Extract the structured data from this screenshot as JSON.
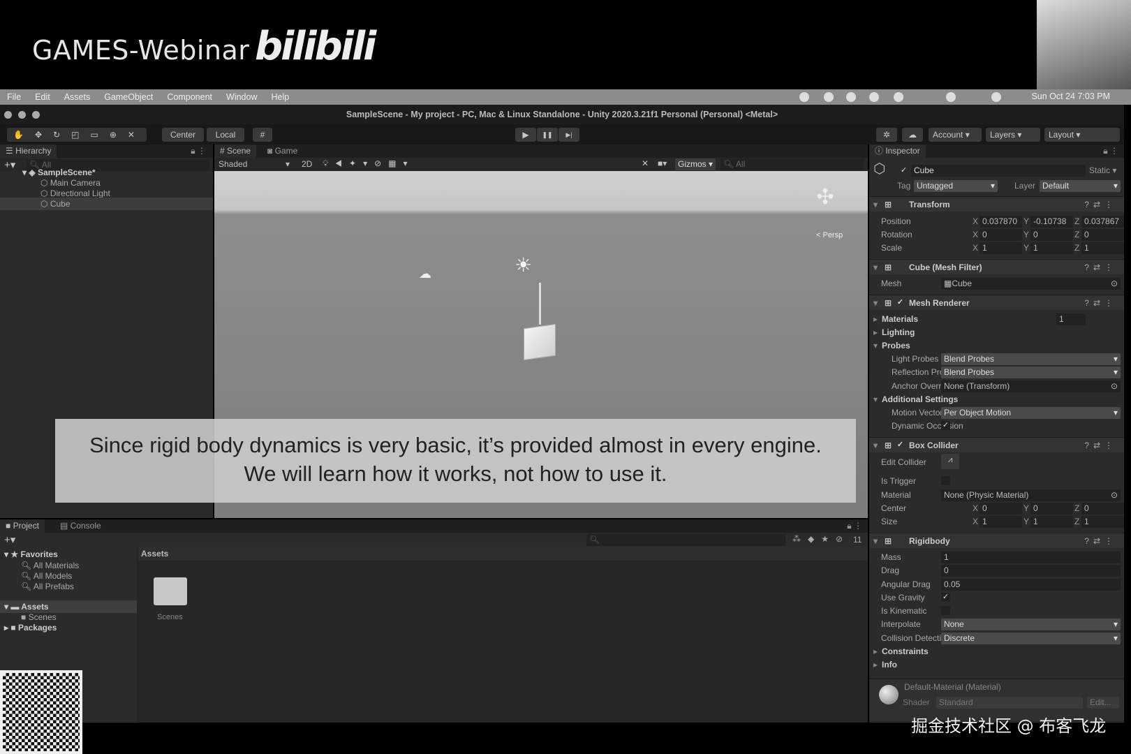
{
  "overlay": {
    "brand": "GAMES-Webinar",
    "logo": "bilibili",
    "watermark": "掘金技术社区 @ 布客飞龙",
    "subtitle_line1": "Since rigid body dynamics is very basic, it’s provided almost in every engine.",
    "subtitle_line2": "We will learn how it works, not how to use it."
  },
  "menubar": {
    "items": [
      "File",
      "Edit",
      "Assets",
      "GameObject",
      "Component",
      "Window",
      "Help"
    ],
    "clock": "Sun Oct 24  7:03 PM"
  },
  "window": {
    "title": "SampleScene - My project - PC, Mac & Linux Standalone - Unity 2020.3.21f1 Personal (Personal) <Metal>"
  },
  "toolbar": {
    "center": "Center",
    "local": "Local",
    "account": "Account",
    "layers": "Layers",
    "layout": "Layout",
    "play_icon": "▶",
    "pause_icon": "❚❚",
    "step_icon": "▶|"
  },
  "hierarchy": {
    "tab": "Hierarchy",
    "search_placeholder": "All",
    "items": [
      {
        "label": "SampleScene*",
        "depth": 0
      },
      {
        "label": "Main Camera",
        "depth": 1
      },
      {
        "label": "Directional Light",
        "depth": 1
      },
      {
        "label": "Cube",
        "depth": 1,
        "selected": true
      }
    ]
  },
  "scene": {
    "tab_scene": "Scene",
    "tab_game": "Game",
    "shading": "Shaded",
    "mode2d": "2D",
    "gizmos": "Gizmos",
    "search_placeholder": "All",
    "persp": "< Persp"
  },
  "inspector": {
    "tab": "Inspector",
    "object_name": "Cube",
    "active": true,
    "static": "Static",
    "tag_label": "Tag",
    "tag": "Untagged",
    "layer_label": "Layer",
    "layer": "Default",
    "rows": [
      {
        "kind": "header",
        "label": "Transform"
      },
      {
        "kind": "vec3",
        "label": "Position",
        "x": "0.037870",
        "y": "-0.10738",
        "z": "0.037867"
      },
      {
        "kind": "vec3",
        "label": "Rotation",
        "x": "0",
        "y": "0",
        "z": "0"
      },
      {
        "kind": "vec3",
        "label": "Scale",
        "x": "1",
        "y": "1",
        "z": "1"
      },
      {
        "kind": "header",
        "label": "Cube (Mesh Filter)"
      },
      {
        "kind": "object",
        "label": "Mesh",
        "value": "Cube"
      },
      {
        "kind": "header",
        "label": "Mesh Renderer",
        "check": true
      },
      {
        "kind": "fold",
        "label": "Materials",
        "value": "1"
      },
      {
        "kind": "fold",
        "label": "Lighting"
      },
      {
        "kind": "foldopen",
        "label": "Probes"
      },
      {
        "kind": "dropdown",
        "label": "Light Probes",
        "value": "Blend Probes",
        "indent": true
      },
      {
        "kind": "dropdown",
        "label": "Reflection Probes",
        "value": "Blend Probes",
        "indent": true
      },
      {
        "kind": "object",
        "label": "Anchor Override",
        "value": "None (Transform)",
        "indent": true
      },
      {
        "kind": "foldopen",
        "label": "Additional Settings"
      },
      {
        "kind": "dropdown",
        "label": "Motion Vectors",
        "value": "Per Object Motion",
        "indent": true
      },
      {
        "kind": "check",
        "label": "Dynamic Occlusion",
        "value": true,
        "indent": true
      },
      {
        "kind": "header",
        "label": "Box Collider",
        "check": true
      },
      {
        "kind": "button",
        "label": "Edit Collider",
        "value": "⩘"
      },
      {
        "kind": "check",
        "label": "Is Trigger",
        "value": false
      },
      {
        "kind": "object",
        "label": "Material",
        "value": "None (Physic Material)"
      },
      {
        "kind": "vec3",
        "label": "Center",
        "x": "0",
        "y": "0",
        "z": "0"
      },
      {
        "kind": "vec3",
        "label": "Size",
        "x": "1",
        "y": "1",
        "z": "1"
      },
      {
        "kind": "header",
        "label": "Rigidbody"
      },
      {
        "kind": "field",
        "label": "Mass",
        "value": "1"
      },
      {
        "kind": "field",
        "label": "Drag",
        "value": "0"
      },
      {
        "kind": "field",
        "label": "Angular Drag",
        "value": "0.05"
      },
      {
        "kind": "check",
        "label": "Use Gravity",
        "value": true
      },
      {
        "kind": "check",
        "label": "Is Kinematic",
        "value": false
      },
      {
        "kind": "dropdown",
        "label": "Interpolate",
        "value": "None"
      },
      {
        "kind": "dropdown",
        "label": "Collision Detection",
        "value": "Discrete"
      },
      {
        "kind": "fold",
        "label": "Constraints"
      },
      {
        "kind": "fold",
        "label": "Info"
      }
    ],
    "material": {
      "name": "Default-Material (Material)",
      "shader_label": "Shader",
      "shader": "Standard",
      "edit": "Edit..."
    }
  },
  "project": {
    "tab_project": "Project",
    "tab_console": "Console",
    "favorites": "Favorites",
    "fav_items": [
      "All Materials",
      "All Models",
      "All Prefabs"
    ],
    "assets": "Assets",
    "scenes": "Scenes",
    "packages": "Packages",
    "breadcrumb": "Assets",
    "folder": "Scenes",
    "hidden_count": "11"
  }
}
